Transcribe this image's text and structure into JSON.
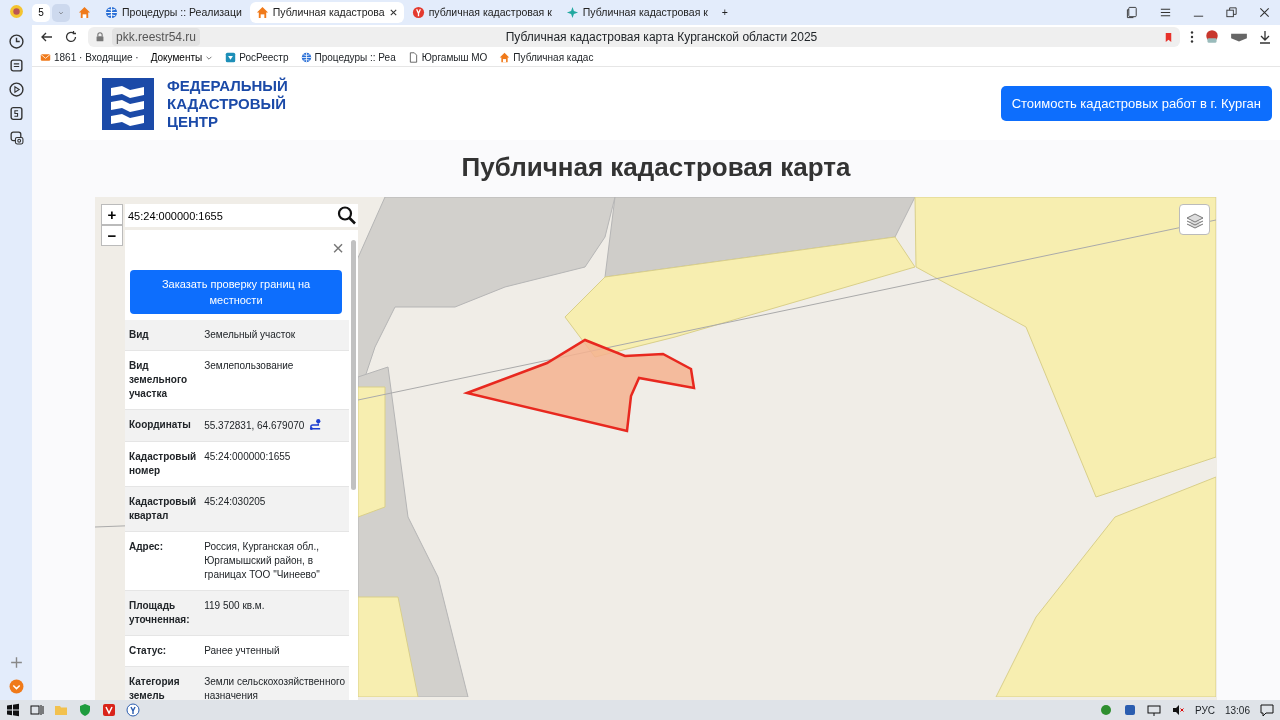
{
  "browser": {
    "tab_count": "5",
    "tabs": [
      {
        "kind": "pinned",
        "selected": false
      },
      {
        "title": "Процедуры :: Реализаци",
        "kind": "globe",
        "selected": false
      },
      {
        "title": "Публичная кадастрова",
        "kind": "house",
        "selected": true
      },
      {
        "title": "публичная кадастровая к",
        "kind": "yandex",
        "selected": false
      },
      {
        "title": "Публичная кадастровая к",
        "kind": "star",
        "selected": false
      }
    ],
    "new_tab": "+",
    "address": "pkk.reestr54.ru",
    "page_title": "Публичная кадастровая карта Курганской области 2025",
    "bookmarks": [
      {
        "title": "1861 · Входящие ·",
        "kind": "mail"
      },
      {
        "title": "Документы",
        "kind": "folder"
      },
      {
        "title": "РосРеестр",
        "kind": "rosreestr"
      },
      {
        "title": "Процедуры :: Реа",
        "kind": "globe"
      },
      {
        "title": "Юргамыш МО",
        "kind": "page"
      },
      {
        "title": "Публичная кадас",
        "kind": "house"
      }
    ]
  },
  "header": {
    "logo_lines": [
      "ФЕДЕРАЛЬНЫЙ",
      "КАДАСТРОВЫЙ",
      "ЦЕНТР"
    ],
    "cta_button": "Стоимость кадастровых работ в г. Курган"
  },
  "heading": "Публичная кадастровая карта",
  "map": {
    "zoom_in": "+",
    "zoom_out": "−",
    "search_value": "45:24:000000:1655",
    "close": "×",
    "order_button": "Заказать проверку границ на местности",
    "properties": [
      {
        "label": "Вид",
        "value": "Земельный участок",
        "kind": "text"
      },
      {
        "label": "Вид земельного участка",
        "value": "Землепользование",
        "kind": "text"
      },
      {
        "label": "Координаты",
        "value": "55.372831, 64.679070",
        "kind": "coordinates"
      },
      {
        "label": "Кадастровый номер",
        "value": "45:24:000000:1655",
        "kind": "text"
      },
      {
        "label": "Кадастровый квартал",
        "value": "45:24:030205",
        "kind": "text"
      },
      {
        "label": "Адрес:",
        "value": "Россия, Курганская обл., Юргамышский район, в границах ТОО \"Чинеево\"",
        "kind": "text"
      },
      {
        "label": "Площадь уточненная:",
        "value": "119 500 кв.м.",
        "kind": "text"
      },
      {
        "label": "Статус:",
        "value": "Ранее учтенный",
        "kind": "text"
      },
      {
        "label": "Категория земель",
        "value": "Земли сельскохозяйственного назначения",
        "kind": "text"
      }
    ]
  },
  "taskbar": {
    "language": "РУС",
    "time": "13:06"
  }
}
